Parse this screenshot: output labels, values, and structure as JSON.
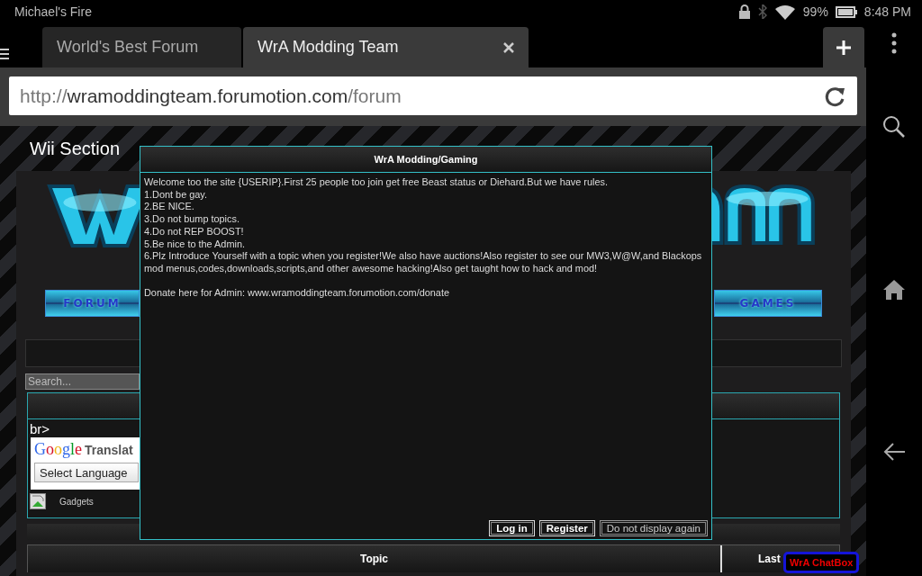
{
  "status_bar": {
    "carrier": "Michael's Fire",
    "battery": "99%",
    "time": "8:48 PM"
  },
  "tabs": [
    {
      "label": "World's Best Forum",
      "selected": false
    },
    {
      "label": "WrA Modding Team",
      "selected": true
    }
  ],
  "address_bar": {
    "scheme": "http://",
    "host": "wramoddingteam.forumotion.com",
    "path": "/forum"
  },
  "page": {
    "nav": [
      "Wii Section"
    ],
    "banner_buttons": [
      "FORUM",
      "GAMES"
    ],
    "search": {
      "placeholder": "Search..."
    },
    "widget": {
      "text": "br>",
      "translate": {
        "brand": "Google",
        "label": "Translat",
        "select": "Select Language"
      },
      "gadgets": "Gadgets"
    },
    "table": {
      "columns": [
        "Topic",
        "Last"
      ]
    },
    "chatbox": "WrA ChatBox"
  },
  "dialog": {
    "title": "WrA Modding/Gaming",
    "lines": [
      "Welcome too the site {USERIP}.First 25 people too join get free Beast status or Diehard.But we have rules.",
      "1.Dont be gay.",
      "2.BE NICE.",
      "3.Do not bump topics.",
      "4.Do not REP BOOST!",
      "5.Be nice to the Admin.",
      "6.Plz Introduce Yourself with a topic when you register!We also have auctions!Also register to see our MW3,W@W,and Blackops mod menus,codes,downloads,scripts,and other awesome hacking!Also get taught how to hack and mod!"
    ],
    "donate": "Donate here for Admin: www.wramoddingteam.forumotion.com/donate",
    "buttons": [
      {
        "label": "Log in",
        "kind": "primary"
      },
      {
        "label": "Register",
        "kind": "primary"
      },
      {
        "label": "Do not display again",
        "kind": "plain"
      }
    ]
  }
}
